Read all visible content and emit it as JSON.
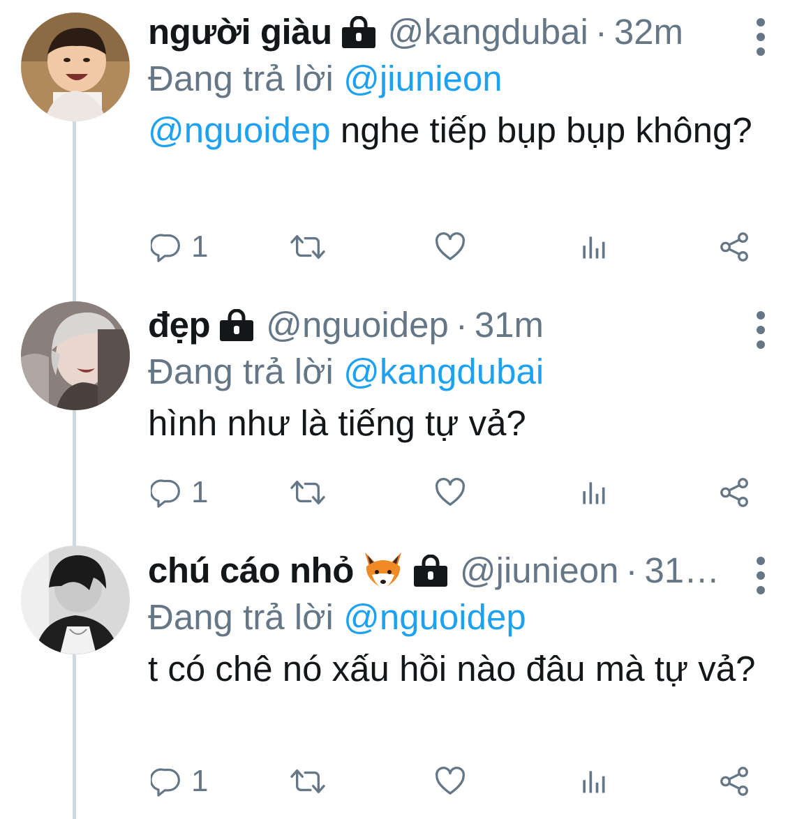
{
  "tweets": [
    {
      "display_name": "người giàu",
      "handle": "@kangdubai",
      "time": "32m",
      "reply_prefix": "Đang trả lời",
      "reply_to": "@jiunieon",
      "mention": "@nguoidep",
      "text": " nghe tiếp bụp bụp không?",
      "reply_count": "1"
    },
    {
      "display_name": "đẹp",
      "handle": "@nguoidep",
      "time": "31m",
      "reply_prefix": "Đang trả lời",
      "reply_to": "@kangdubai",
      "text": "hình như là tiếng tự vả?",
      "reply_count": "1"
    },
    {
      "display_name": "chú cáo nhỏ",
      "handle": "@jiunieon",
      "time": "31…",
      "reply_prefix": "Đang trả lời",
      "reply_to": "@nguoidep",
      "text": "t có chê nó xấu hồi nào đâu mà tự vả?",
      "reply_count": "1"
    }
  ],
  "colors": {
    "link": "#1da1f2",
    "meta": "#657786",
    "text": "#14171a",
    "thread_line": "#cfd9de"
  },
  "icons": [
    "reply-icon",
    "retweet-icon",
    "like-icon",
    "analytics-icon",
    "share-icon",
    "lock-icon",
    "more-icon",
    "fox-emoji"
  ]
}
